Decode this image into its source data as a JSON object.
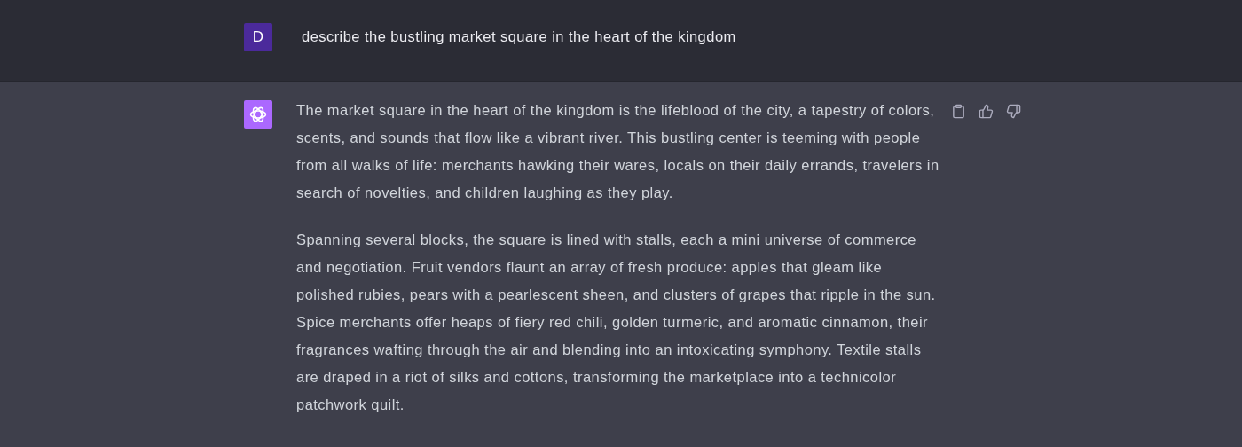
{
  "messages": [
    {
      "kind": "user",
      "avatar": "D",
      "paragraphs": [
        "describe the bustling market square in the heart of the kingdom"
      ]
    },
    {
      "kind": "assistant",
      "paragraphs": [
        "The market square in the heart of the kingdom is the lifeblood of the city, a tapestry of colors, scents, and sounds that flow like a vibrant river. This bustling center is teeming with people from all walks of life: merchants hawking their wares, locals on their daily errands, travelers in search of novelties, and children laughing as they play.",
        "Spanning several blocks, the square is lined with stalls, each a mini universe of commerce and negotiation. Fruit vendors flaunt an array of fresh produce: apples that gleam like polished rubies, pears with a pearlescent sheen, and clusters of grapes that ripple in the sun. Spice merchants offer heaps of fiery red chili, golden turmeric, and aromatic cinnamon, their fragrances wafting through the air and blending into an intoxicating symphony. Textile stalls are draped in a riot of silks and cottons, transforming the marketplace into a technicolor patchwork quilt."
      ]
    }
  ]
}
